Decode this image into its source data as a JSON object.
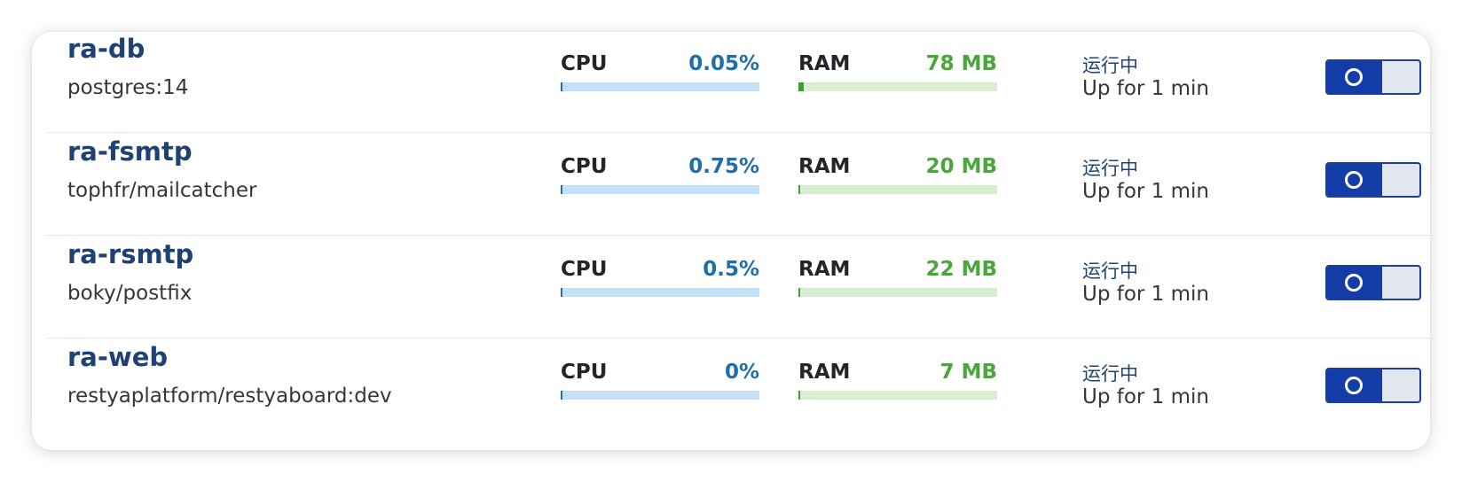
{
  "containers": [
    {
      "name": "ra-db",
      "image": "postgres:14",
      "cpu_label": "CPU",
      "cpu_value": "0.05%",
      "cpu_fraction": 0.0005,
      "ram_label": "RAM",
      "ram_value": "78 MB",
      "ram_fraction": 0.025,
      "status": "运行中",
      "uptime": "Up for 1 min",
      "enabled": true
    },
    {
      "name": "ra-fsmtp",
      "image": "tophfr/mailcatcher",
      "cpu_label": "CPU",
      "cpu_value": "0.75%",
      "cpu_fraction": 0.0075,
      "ram_label": "RAM",
      "ram_value": "20 MB",
      "ram_fraction": 0.007,
      "status": "运行中",
      "uptime": "Up for 1 min",
      "enabled": true
    },
    {
      "name": "ra-rsmtp",
      "image": "boky/postfix",
      "cpu_label": "CPU",
      "cpu_value": "0.5%",
      "cpu_fraction": 0.005,
      "ram_label": "RAM",
      "ram_value": "22 MB",
      "ram_fraction": 0.007,
      "status": "运行中",
      "uptime": "Up for 1 min",
      "enabled": true
    },
    {
      "name": "ra-web",
      "image": "restyaplatform/restyaboard:dev",
      "cpu_label": "CPU",
      "cpu_value": "0%",
      "cpu_fraction": 0,
      "ram_label": "RAM",
      "ram_value": "7 MB",
      "ram_fraction": 0.003,
      "status": "运行中",
      "uptime": "Up for 1 min",
      "enabled": true
    }
  ],
  "colors": {
    "name": "#1f4173",
    "cpu_accent": "#1e6fa8",
    "ram_accent": "#4aa63a",
    "toggle_on": "#143ca6"
  }
}
